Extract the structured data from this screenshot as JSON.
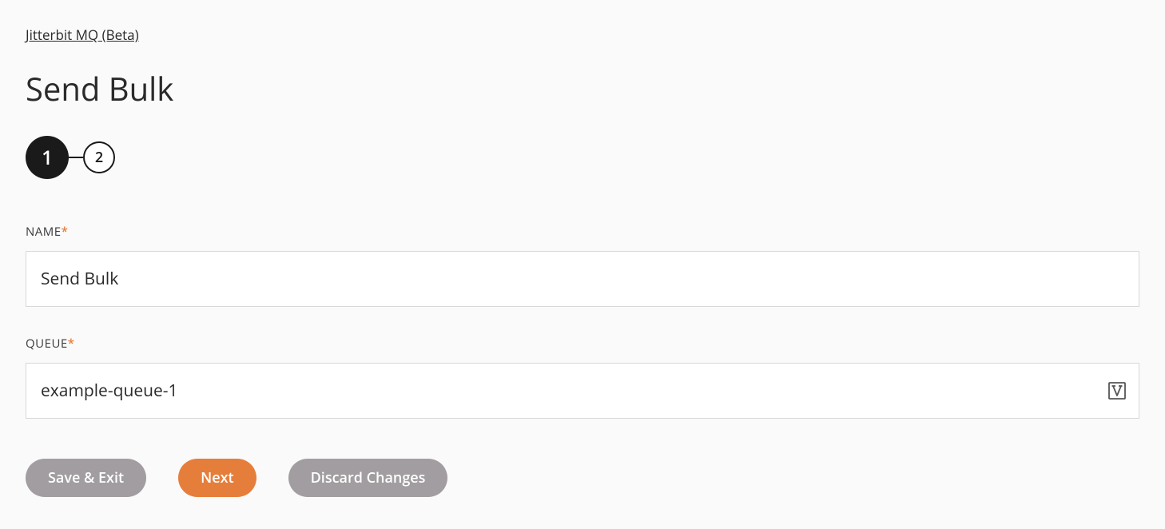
{
  "breadcrumb": {
    "label": "Jitterbit MQ (Beta)"
  },
  "page": {
    "title": "Send Bulk"
  },
  "steps": {
    "current": "1",
    "next": "2"
  },
  "form": {
    "name": {
      "label": "NAME",
      "value": "Send Bulk"
    },
    "queue": {
      "label": "QUEUE",
      "value": "example-queue-1"
    }
  },
  "buttons": {
    "save_exit": "Save & Exit",
    "next": "Next",
    "discard": "Discard Changes"
  }
}
